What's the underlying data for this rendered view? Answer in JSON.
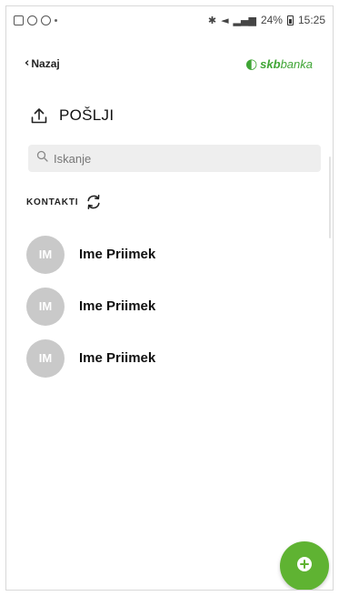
{
  "status_bar": {
    "battery": "24%",
    "time": "15:25"
  },
  "header": {
    "back_label": "Nazaj",
    "brand_prefix": "skb",
    "brand_suffix": "banka"
  },
  "page": {
    "title": "POŠLJI"
  },
  "search": {
    "placeholder": "Iskanje",
    "value": ""
  },
  "contacts": {
    "label": "KONTAKTI",
    "items": [
      {
        "initials": "IM",
        "name": "Ime Priimek"
      },
      {
        "initials": "IM",
        "name": "Ime Priimek"
      },
      {
        "initials": "IM",
        "name": "Ime Priimek"
      }
    ]
  },
  "colors": {
    "accent": "#5fb332",
    "brand": "#3fa535",
    "avatar_bg": "#c9c9c9",
    "search_bg": "#eeeeee"
  },
  "icons": {
    "back": "chevron-left-icon",
    "upload": "upload-icon",
    "search": "search-icon",
    "refresh": "refresh-icon",
    "fab": "add-icon"
  }
}
